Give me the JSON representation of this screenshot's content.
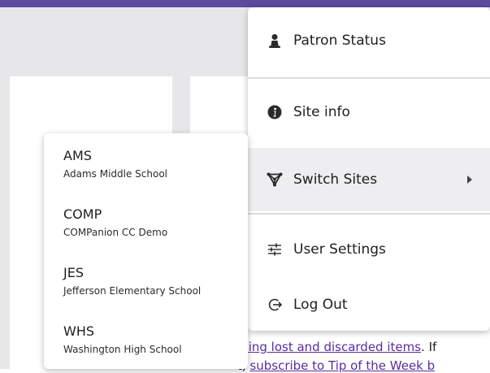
{
  "article": {
    "line1_link": "dling lost and discarded items",
    "line1_rest": ". If",
    "line2_prefix": "t, ",
    "line2_link": "subscribe to Tip of the Week b"
  },
  "menu": {
    "patron_status": "Patron Status",
    "site_info": "Site info",
    "switch_sites": "Switch Sites",
    "user_settings": "User Settings",
    "log_out": "Log Out"
  },
  "sites": [
    {
      "code": "AMS",
      "name": "Adams Middle School"
    },
    {
      "code": "COMP",
      "name": "COMPanion CC Demo"
    },
    {
      "code": "JES",
      "name": "Jefferson Elementary School"
    },
    {
      "code": "WHS",
      "name": "Washington High School"
    }
  ],
  "colors": {
    "accent": "#5b4a9e",
    "link": "#5a2ca0",
    "hover": "#eeeef0"
  }
}
